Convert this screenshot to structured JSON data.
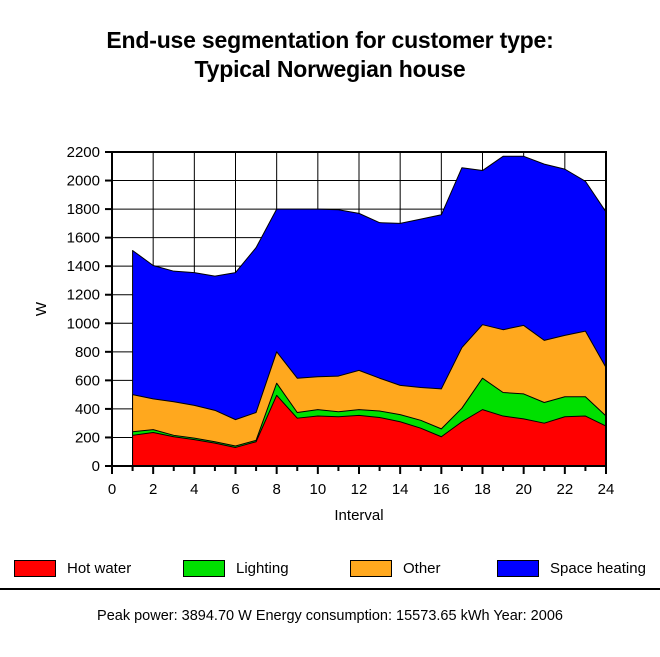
{
  "title": {
    "line1": "End-use segmentation for customer type:",
    "line2": "Typical Norwegian house"
  },
  "footer": {
    "text": "Peak power: 3894.70 W  Energy consumption: 15573.65 kWh Year: 2006"
  },
  "legend": {
    "position": "bottom",
    "items": [
      {
        "label": "Hot water",
        "color": "#FF0000"
      },
      {
        "label": "Lighting",
        "color": "#00E000"
      },
      {
        "label": "Other",
        "color": "#FFA81E"
      },
      {
        "label": "Space heating",
        "color": "#0000FF"
      }
    ]
  },
  "axes": {
    "x": {
      "label": "Interval",
      "min": 0,
      "max": 24,
      "tick_step": 2,
      "minor_tick_step": 1,
      "ticks": [
        "0",
        "2",
        "4",
        "6",
        "8",
        "10",
        "12",
        "14",
        "16",
        "18",
        "20",
        "22",
        "24"
      ]
    },
    "y": {
      "label": "W",
      "min": 0,
      "max": 2200,
      "tick_step": 200,
      "ticks": [
        "0",
        "200",
        "400",
        "600",
        "800",
        "1000",
        "1200",
        "1400",
        "1600",
        "1800",
        "2000",
        "2200"
      ]
    },
    "grid": true
  },
  "chart_data": {
    "type": "area",
    "stacked": true,
    "title": "End-use segmentation for customer type: Typical Norwegian house",
    "subtitle": "",
    "xlabel": "Interval",
    "ylabel": "W",
    "xlim": [
      0,
      24
    ],
    "ylim": [
      0,
      2200
    ],
    "grid": true,
    "legend_position": "bottom",
    "x": [
      1,
      2,
      3,
      4,
      5,
      6,
      7,
      8,
      9,
      10,
      11,
      12,
      13,
      14,
      15,
      16,
      17,
      18,
      19,
      20,
      21,
      22,
      23,
      24
    ],
    "series": [
      {
        "name": "Hot water",
        "color": "#FF0000",
        "values": [
          215,
          235,
          205,
          185,
          160,
          130,
          170,
          495,
          335,
          350,
          345,
          355,
          340,
          310,
          265,
          205,
          310,
          395,
          350,
          330,
          300,
          345,
          350,
          280
        ]
      },
      {
        "name": "Lighting",
        "color": "#00E000",
        "values": [
          25,
          20,
          10,
          10,
          10,
          10,
          10,
          85,
          40,
          45,
          35,
          40,
          45,
          50,
          55,
          55,
          95,
          220,
          165,
          175,
          145,
          140,
          135,
          70
        ]
      },
      {
        "name": "Other",
        "color": "#FFA81E",
        "values": [
          260,
          215,
          235,
          230,
          220,
          185,
          195,
          220,
          240,
          230,
          250,
          275,
          230,
          205,
          230,
          280,
          425,
          375,
          440,
          480,
          435,
          430,
          460,
          340
        ]
      },
      {
        "name": "Space heating",
        "color": "#0000FF",
        "values": [
          1010,
          935,
          915,
          930,
          940,
          1030,
          1155,
          1000,
          1185,
          1175,
          1165,
          1100,
          1090,
          1135,
          1180,
          1220,
          1260,
          1080,
          1215,
          1185,
          1235,
          1165,
          1050,
          1090
        ]
      }
    ],
    "totals": [
      1510,
      1405,
      1365,
      1355,
      1330,
      1355,
      1530,
      1800,
      1800,
      1800,
      1795,
      1770,
      1705,
      1700,
      1730,
      1760,
      2090,
      2070,
      2170,
      2170,
      2115,
      2080,
      1995,
      1780
    ]
  }
}
